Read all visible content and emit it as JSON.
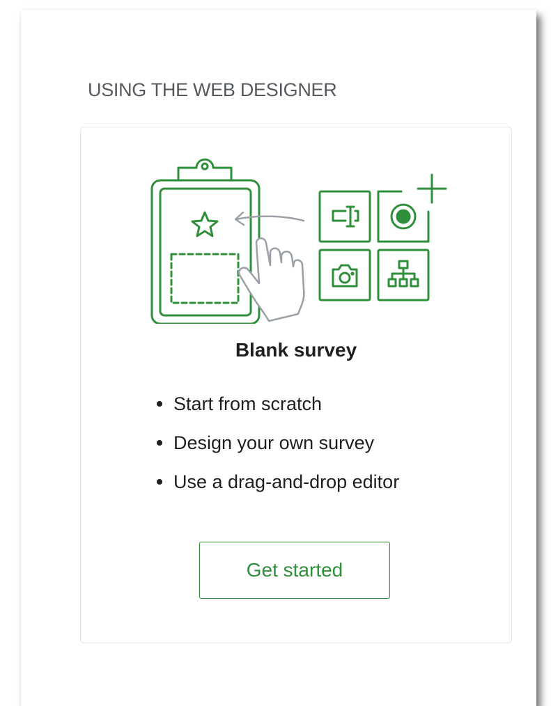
{
  "section": {
    "title": "USING THE WEB DESIGNER"
  },
  "card": {
    "title": "Blank survey",
    "features": [
      "Start from scratch",
      "Design your own survey",
      "Use a drag-and-drop editor"
    ],
    "button_label": "Get started"
  },
  "colors": {
    "accent_green": "#2f8f3a",
    "title_gray": "#55595e",
    "text_dark": "#1f1f1f",
    "card_border": "#e3e6ea"
  },
  "illustration": {
    "icons": [
      "clipboard-icon",
      "star-icon",
      "arrow-icon",
      "hand-pointer-icon",
      "text-field-icon",
      "radio-button-icon",
      "plus-icon",
      "camera-icon",
      "hierarchy-icon"
    ]
  }
}
